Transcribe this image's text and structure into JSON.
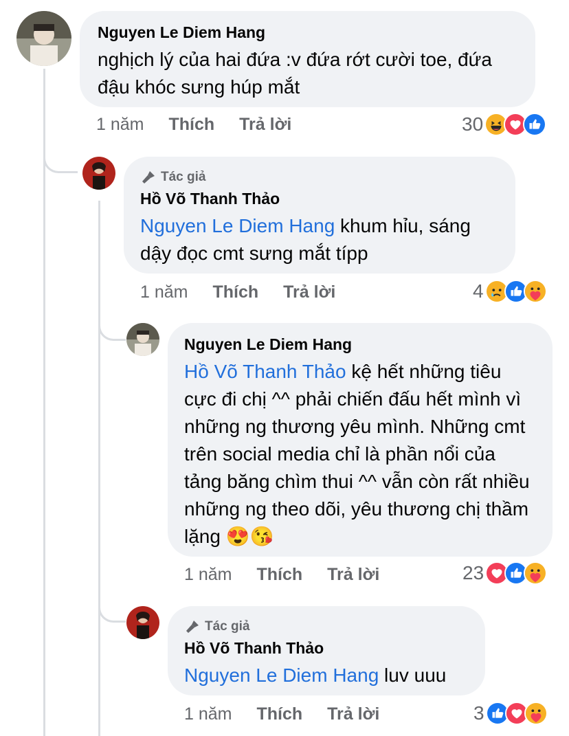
{
  "comments": [
    {
      "author": "Nguyen Le Diem Hang",
      "text": "nghịch lý của hai đứa :v đứa rớt cười toe, đứa đậu khóc sưng húp mắt",
      "time": "1 năm",
      "like_label": "Thích",
      "reply_label": "Trả lời",
      "reaction_count": "30",
      "reactions": [
        "haha-icon",
        "love-icon",
        "like-icon"
      ]
    },
    {
      "author_badge": "Tác giả",
      "author": "Hồ Võ Thanh Thảo",
      "mention": "Nguyen Le Diem Hang",
      "text": " khum hỉu, sáng dậy đọc cmt sưng mắt típp",
      "time": "1 năm",
      "like_label": "Thích",
      "reply_label": "Trả lời",
      "reaction_count": "4",
      "reactions": [
        "sad-icon",
        "like-icon",
        "care-icon"
      ]
    },
    {
      "author": "Nguyen Le Diem Hang",
      "mention": "Hồ Võ Thanh Thảo",
      "text": " kệ hết những tiêu cực đi chị ^^ phải chiến đấu hết mình vì những ng thương yêu mình. Những cmt trên social media chỉ là phần nổi của tảng băng chìm thui ^^ vẫn còn rất nhiều những ng theo dõi, yêu thương chị thầm lặng 😍😘",
      "time": "1 năm",
      "like_label": "Thích",
      "reply_label": "Trả lời",
      "reaction_count": "23",
      "reactions": [
        "love-icon",
        "like-icon",
        "care-icon"
      ]
    },
    {
      "author_badge": "Tác giả",
      "author": "Hồ Võ Thanh Thảo",
      "mention": "Nguyen Le Diem Hang",
      "text": " luv uuu",
      "time": "1 năm",
      "like_label": "Thích",
      "reply_label": "Trả lời",
      "reaction_count": "3",
      "reactions": [
        "like-icon",
        "love-icon",
        "care-icon"
      ]
    }
  ],
  "colors": {
    "like": "#1877f2",
    "love": "#f33e58",
    "haha": "#f7b125",
    "mention": "#216fdb"
  }
}
